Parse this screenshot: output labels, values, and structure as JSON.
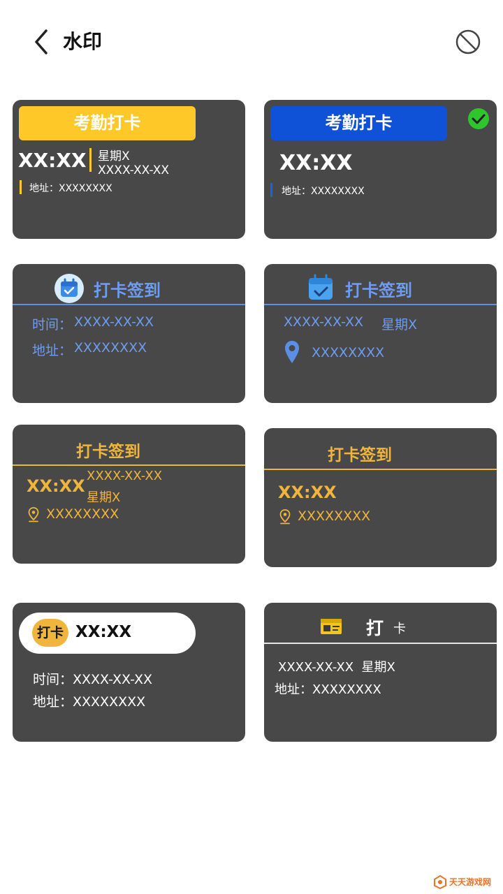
{
  "header": {
    "title": "水印"
  },
  "cards": {
    "c1": {
      "banner": "考勤打卡",
      "time": "XX:XX",
      "weekday": "星期X",
      "date": "XXXX-XX-XX",
      "address": "地址：XXXXXXXX"
    },
    "c2": {
      "banner": "考勤打卡",
      "time": "XX:XX",
      "address": "地址：XXXXXXXX",
      "selected": true
    },
    "c3": {
      "title": "打卡签到",
      "time_label": "时间：",
      "time_value": "XXXX-XX-XX",
      "addr_label": "地址：",
      "addr_value": "XXXXXXXX"
    },
    "c4": {
      "title": "打卡签到",
      "date": "XXXX-XX-XX",
      "weekday": "星期X",
      "address": "XXXXXXXX"
    },
    "c5": {
      "title": "打卡签到",
      "time": "XX:XX",
      "date": "XXXX-XX-XX",
      "weekday": "星期X",
      "address": "XXXXXXXX"
    },
    "c6": {
      "title": "打卡签到",
      "time": "XX:XX",
      "address": "XXXXXXXX"
    },
    "c7": {
      "badge": "打卡",
      "time": "XX:XX",
      "time_line": "时间：XXXX-XX-XX",
      "addr_line": "地址：XXXXXXXX"
    },
    "c8": {
      "title_main": "打",
      "title_small": "卡",
      "date_line": "XXXX-XX-XX  星期X",
      "addr_line": "地址：XXXXXXXX"
    }
  },
  "watermark": {
    "text": "天天游戏网"
  },
  "colors": {
    "card_bg": "#484848",
    "yellow": "#fdc828",
    "blue_banner": "#0f52d8",
    "blue_text": "#6d9cf0",
    "gold": "#f0b53c",
    "green_check": "#2ec52e"
  },
  "icons": [
    "back-arrow-icon",
    "no-watermark-icon",
    "check-circle-icon",
    "calendar-icon",
    "location-pin-icon",
    "id-card-icon"
  ]
}
